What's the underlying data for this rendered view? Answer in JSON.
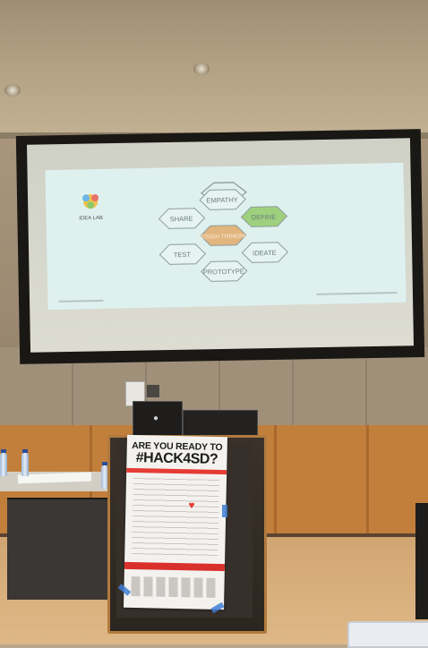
{
  "slide": {
    "logo_text": "IDEA LAB",
    "hexagons": [
      "EMPATHY",
      "SHARE",
      "DEFINE",
      "DESIGN THINKING",
      "TEST",
      "IDEATE",
      "PROTOTYPE"
    ],
    "footer_left": "",
    "footer_right": ""
  },
  "poster": {
    "line1": "ARE YOU READY TO",
    "line2": "#HACK4SD?"
  },
  "laptop": {
    "logo": ""
  },
  "colors": {
    "slide_bg": "#dff1ef",
    "hex_define": "#9fd07e",
    "hex_center": "#e2b57e",
    "poster_red": "#e53c35",
    "podium_trim": "#b07a3d"
  }
}
